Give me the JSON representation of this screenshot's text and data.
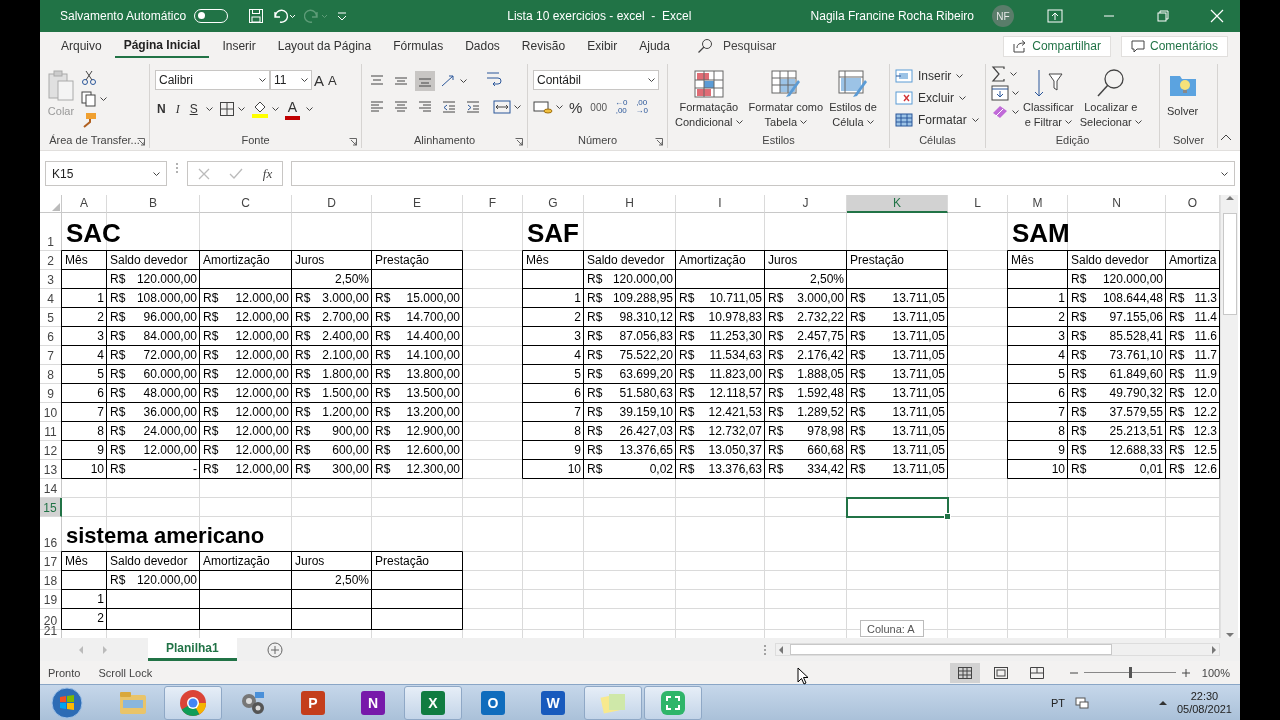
{
  "title_bar": {
    "autosave_label": "Salvamento Automático",
    "autosave_on": false,
    "document_title": "Lista 10 exercicios - excel  -  Excel",
    "user_name": "Nagila Francine Rocha Ribeiro",
    "user_initials": "NF"
  },
  "menu_tabs": [
    {
      "label": "Arquivo",
      "selected": false
    },
    {
      "label": "Página Inicial",
      "selected": true
    },
    {
      "label": "Inserir",
      "selected": false
    },
    {
      "label": "Layout da Página",
      "selected": false
    },
    {
      "label": "Fórmulas",
      "selected": false
    },
    {
      "label": "Dados",
      "selected": false
    },
    {
      "label": "Revisão",
      "selected": false
    },
    {
      "label": "Exibir",
      "selected": false
    },
    {
      "label": "Ajuda",
      "selected": false
    }
  ],
  "search": {
    "placeholder": "Pesquisar"
  },
  "share_button": "Compartilhar",
  "comments_button": "Comentários",
  "ribbon": {
    "clipboard": {
      "label": "Área de Transfer...",
      "paste": "Colar"
    },
    "font": {
      "label": "Fonte",
      "family": "Calibri",
      "size": "11",
      "grow": "A",
      "shrink": "A",
      "bold": "N",
      "italic": "I",
      "underline": "S",
      "color_letter": "A"
    },
    "alignment": {
      "label": "Alinhamento"
    },
    "number": {
      "label": "Número",
      "format": "Contábil",
      "percent": "%",
      "thousands": "000",
      "decimals": [
        {
          "top": "←0",
          "bottom": ",00"
        },
        {
          "top": ",00",
          "bottom": "→0"
        }
      ]
    },
    "styles": {
      "label": "Estilos",
      "buttons": [
        {
          "line1": "Formatação",
          "line2": "Condicional"
        },
        {
          "line1": "Formatar como",
          "line2": "Tabela"
        },
        {
          "line1": "Estilos de",
          "line2": "Célula"
        }
      ]
    },
    "cells": {
      "label": "Células",
      "buttons": [
        "Inserir",
        "Excluir",
        "Formatar"
      ]
    },
    "editing": {
      "label": "Edição",
      "buttons": [
        {
          "line1": "Classificar",
          "line2": "e Filtrar"
        },
        {
          "line1": "Localizar e",
          "line2": "Selecionar"
        }
      ]
    },
    "solver": {
      "label": "Solver",
      "button": "Solver"
    }
  },
  "name_box": "K15",
  "formula_label": "fx",
  "columns": [
    {
      "letter": "A",
      "selected": false
    },
    {
      "letter": "B",
      "selected": false
    },
    {
      "letter": "C",
      "selected": false
    },
    {
      "letter": "D",
      "selected": false
    },
    {
      "letter": "E",
      "selected": false
    },
    {
      "letter": "F",
      "selected": false
    },
    {
      "letter": "G",
      "selected": false
    },
    {
      "letter": "H",
      "selected": false
    },
    {
      "letter": "I",
      "selected": false
    },
    {
      "letter": "J",
      "selected": false
    },
    {
      "letter": "K",
      "selected": true
    },
    {
      "letter": "L",
      "selected": false
    },
    {
      "letter": "M",
      "selected": false
    },
    {
      "letter": "N",
      "selected": false
    },
    {
      "letter": "O",
      "selected": false
    }
  ],
  "rows": [
    {
      "number": "1",
      "selected": false
    },
    {
      "number": "2",
      "selected": false
    },
    {
      "number": "3",
      "selected": false
    },
    {
      "number": "4",
      "selected": false
    },
    {
      "number": "5",
      "selected": false
    },
    {
      "number": "6",
      "selected": false
    },
    {
      "number": "7",
      "selected": false
    },
    {
      "number": "8",
      "selected": false
    },
    {
      "number": "9",
      "selected": false
    },
    {
      "number": "10",
      "selected": false
    },
    {
      "number": "11",
      "selected": false
    },
    {
      "number": "12",
      "selected": false
    },
    {
      "number": "13",
      "selected": false
    },
    {
      "number": "14",
      "selected": false
    },
    {
      "number": "15",
      "selected": true
    },
    {
      "number": "16",
      "selected": false
    },
    {
      "number": "17",
      "selected": false
    },
    {
      "number": "18",
      "selected": false
    },
    {
      "number": "19",
      "selected": false
    },
    {
      "number": "20",
      "selected": false
    },
    {
      "number": "21",
      "selected": false
    }
  ],
  "tables": [
    {
      "title": "SAC",
      "headers": [
        "Mês",
        "Saldo devedor",
        "Amortização",
        "Juros",
        "Prestação"
      ],
      "rows": [
        {
          "balance": "R$ 120.000,00",
          "rate": "2,50%"
        },
        {
          "month": "1",
          "balance": "R$ 108.000,00",
          "amortization": "R$ 12.000,00",
          "interest": "R$ 3.000,00",
          "payment": "R$ 15.000,00"
        },
        {
          "month": "2",
          "balance": "R$ 96.000,00",
          "amortization": "R$ 12.000,00",
          "interest": "R$ 2.700,00",
          "payment": "R$ 14.700,00"
        },
        {
          "month": "3",
          "balance": "R$ 84.000,00",
          "amortization": "R$ 12.000,00",
          "interest": "R$ 2.400,00",
          "payment": "R$ 14.400,00"
        },
        {
          "month": "4",
          "balance": "R$ 72.000,00",
          "amortization": "R$ 12.000,00",
          "interest": "R$ 2.100,00",
          "payment": "R$ 14.100,00"
        },
        {
          "month": "5",
          "balance": "R$ 60.000,00",
          "amortization": "R$ 12.000,00",
          "interest": "R$ 1.800,00",
          "payment": "R$ 13.800,00"
        },
        {
          "month": "6",
          "balance": "R$ 48.000,00",
          "amortization": "R$ 12.000,00",
          "interest": "R$ 1.500,00",
          "payment": "R$ 13.500,00"
        },
        {
          "month": "7",
          "balance": "R$ 36.000,00",
          "amortization": "R$ 12.000,00",
          "interest": "R$ 1.200,00",
          "payment": "R$ 13.200,00"
        },
        {
          "month": "8",
          "balance": "R$ 24.000,00",
          "amortization": "R$ 12.000,00",
          "interest": "R$ 900,00",
          "payment": "R$ 12.900,00"
        },
        {
          "month": "9",
          "balance": "R$ 12.000,00",
          "amortization": "R$ 12.000,00",
          "interest": "R$ 600,00",
          "payment": "R$ 12.600,00"
        },
        {
          "month": "10",
          "balance": "R$ -",
          "amortization": "R$ 12.000,00",
          "interest": "R$ 300,00",
          "payment": "R$ 12.300,00"
        }
      ]
    },
    {
      "title": "SAF",
      "headers": [
        "Mês",
        "Saldo devedor",
        "Amortização",
        "Juros",
        "Prestação"
      ],
      "rows": [
        {
          "balance": "R$ 120.000,00",
          "rate": "2,50%"
        },
        {
          "month": "1",
          "balance": "R$ 109.288,95",
          "amortization": "R$ 10.711,05",
          "interest": "R$ 3.000,00",
          "payment": "R$ 13.711,05"
        },
        {
          "month": "2",
          "balance": "R$ 98.310,12",
          "amortization": "R$ 10.978,83",
          "interest": "R$ 2.732,22",
          "payment": "R$ 13.711,05"
        },
        {
          "month": "3",
          "balance": "R$ 87.056,83",
          "amortization": "R$ 11.253,30",
          "interest": "R$ 2.457,75",
          "payment": "R$ 13.711,05"
        },
        {
          "month": "4",
          "balance": "R$ 75.522,20",
          "amortization": "R$ 11.534,63",
          "interest": "R$ 2.176,42",
          "payment": "R$ 13.711,05"
        },
        {
          "month": "5",
          "balance": "R$ 63.699,20",
          "amortization": "R$ 11.823,00",
          "interest": "R$ 1.888,05",
          "payment": "R$ 13.711,05"
        },
        {
          "month": "6",
          "balance": "R$ 51.580,63",
          "amortization": "R$ 12.118,57",
          "interest": "R$ 1.592,48",
          "payment": "R$ 13.711,05"
        },
        {
          "month": "7",
          "balance": "R$ 39.159,10",
          "amortization": "R$ 12.421,53",
          "interest": "R$ 1.289,52",
          "payment": "R$ 13.711,05"
        },
        {
          "month": "8",
          "balance": "R$ 26.427,03",
          "amortization": "R$ 12.732,07",
          "interest": "R$ 978,98",
          "payment": "R$ 13.711,05"
        },
        {
          "month": "9",
          "balance": "R$ 13.376,65",
          "amortization": "R$ 13.050,37",
          "interest": "R$ 660,68",
          "payment": "R$ 13.711,05"
        },
        {
          "month": "10",
          "balance": "R$ 0,02",
          "amortization": "R$ 13.376,63",
          "interest": "R$ 334,42",
          "payment": "R$ 13.711,05"
        }
      ]
    },
    {
      "title": "SAM",
      "headers": [
        "Mês",
        "Saldo devedor",
        "Amortiza"
      ],
      "rows": [
        {
          "balance": "R$ 120.000,00"
        },
        {
          "month": "1",
          "balance": "R$ 108.644,48",
          "amortization": "R$ 11.3"
        },
        {
          "month": "2",
          "balance": "R$ 97.155,06",
          "amortization": "R$ 11.4"
        },
        {
          "month": "3",
          "balance": "R$ 85.528,41",
          "amortization": "R$ 11.6"
        },
        {
          "month": "4",
          "balance": "R$ 73.761,10",
          "amortization": "R$ 11.7"
        },
        {
          "month": "5",
          "balance": "R$ 61.849,60",
          "amortization": "R$ 11.9"
        },
        {
          "month": "6",
          "balance": "R$ 49.790,32",
          "amortization": "R$ 12.0"
        },
        {
          "month": "7",
          "balance": "R$ 37.579,55",
          "amortization": "R$ 12.2"
        },
        {
          "month": "8",
          "balance": "R$ 25.213,51",
          "amortization": "R$ 12.3"
        },
        {
          "month": "9",
          "balance": "R$ 12.688,33",
          "amortization": "R$ 12.5"
        },
        {
          "month": "10",
          "balance": "R$ 0,01",
          "amortization": "R$ 12.6"
        }
      ]
    },
    {
      "title": "sistema americano",
      "headers": [
        "Mês",
        "Saldo devedor",
        "Amortização",
        "Juros",
        "Prestação"
      ],
      "rows": [
        {
          "balance": "R$ 120.000,00",
          "rate": "2,50%"
        },
        {
          "month": "1"
        },
        {
          "month": "2"
        }
      ]
    }
  ],
  "tooltip": "Coluna: A",
  "sheet_tabs": [
    {
      "label": "Planilha1",
      "selected": true
    }
  ],
  "status_bar": {
    "items": [
      "Pronto",
      "Scroll Lock"
    ],
    "views": [
      {
        "kind": "normal",
        "selected": true
      },
      {
        "kind": "layout",
        "selected": false
      },
      {
        "kind": "break",
        "selected": false
      }
    ],
    "zoom": {
      "level": 0.5,
      "reading": "100%"
    }
  },
  "taskbar": {
    "apps": [
      {
        "kind": "folder",
        "open": false
      },
      {
        "kind": "chrome",
        "open": true
      },
      {
        "kind": "tool",
        "open": false
      },
      {
        "kind": "office",
        "letter": "P",
        "color": "#c43e1c",
        "open": false
      },
      {
        "kind": "office",
        "letter": "N",
        "color": "#7719aa",
        "open": false
      },
      {
        "kind": "office",
        "letter": "X",
        "color": "#107c41",
        "open": true
      },
      {
        "kind": "office",
        "letter": "O",
        "color": "#0f6cbd",
        "open": false
      },
      {
        "kind": "office",
        "letter": "W",
        "color": "#185abd",
        "open": false
      },
      {
        "kind": "notes",
        "open": true
      },
      {
        "kind": "snip",
        "open": true
      }
    ],
    "language": "PT",
    "time": "22:30",
    "date": "05/08/2021"
  }
}
